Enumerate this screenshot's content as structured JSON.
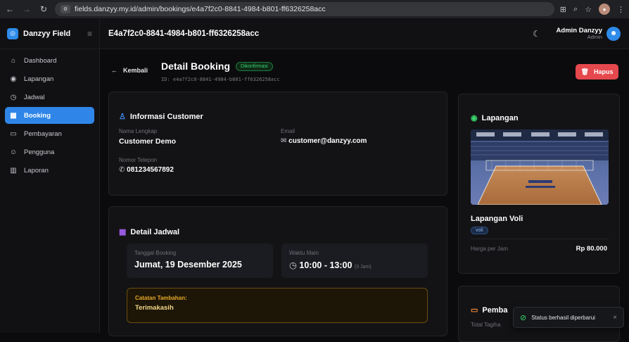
{
  "browser": {
    "url": "fields.danzyy.my.id/admin/bookings/e4a7f2c0-8841-4984-b801-ff6326258acc"
  },
  "sidebar": {
    "brand": "Danzyy Field",
    "items": [
      {
        "label": "Dashboard"
      },
      {
        "label": "Lapangan"
      },
      {
        "label": "Jadwal"
      },
      {
        "label": "Booking"
      },
      {
        "label": "Pembayaran"
      },
      {
        "label": "Pengguna"
      },
      {
        "label": "Laporan"
      }
    ]
  },
  "topbar": {
    "title": "E4a7f2c0-8841-4984-b801-ff6326258acc",
    "user_name": "Admin Danzyy",
    "user_role": "Admin"
  },
  "header": {
    "back_label": "Kembali",
    "title": "Detail Booking",
    "status": "Dikonfirmasi",
    "id_text": "ID: e4a7f2c0-8841-4984-b801-ff6326258acc",
    "delete_label": "Hapus"
  },
  "customer": {
    "title": "Informasi Customer",
    "name_label": "Nama Lengkap",
    "name": "Customer Demo",
    "email_label": "Email",
    "email": "customer@danzyy.com",
    "phone_label": "Nomor Telepon",
    "phone": "081234567892"
  },
  "schedule": {
    "title": "Detail Jadwal",
    "date_label": "Tanggal Booking",
    "date": "Jumat, 19 Desember 2025",
    "time_label": "Waktu Main",
    "time": "10:00 - 13:00",
    "duration": "(3 Jam)",
    "note_label": "Catatan Tambahan:",
    "note": "Terimakasih"
  },
  "field": {
    "title": "Lapangan",
    "name": "Lapangan Voli",
    "tag": "voli",
    "price_label": "Harga per Jam",
    "price": "Rp 80.000"
  },
  "payment": {
    "title": "Pemba",
    "total_label": "Total Tagiha"
  },
  "toast": {
    "message": "Status berhasil diperbarui"
  }
}
